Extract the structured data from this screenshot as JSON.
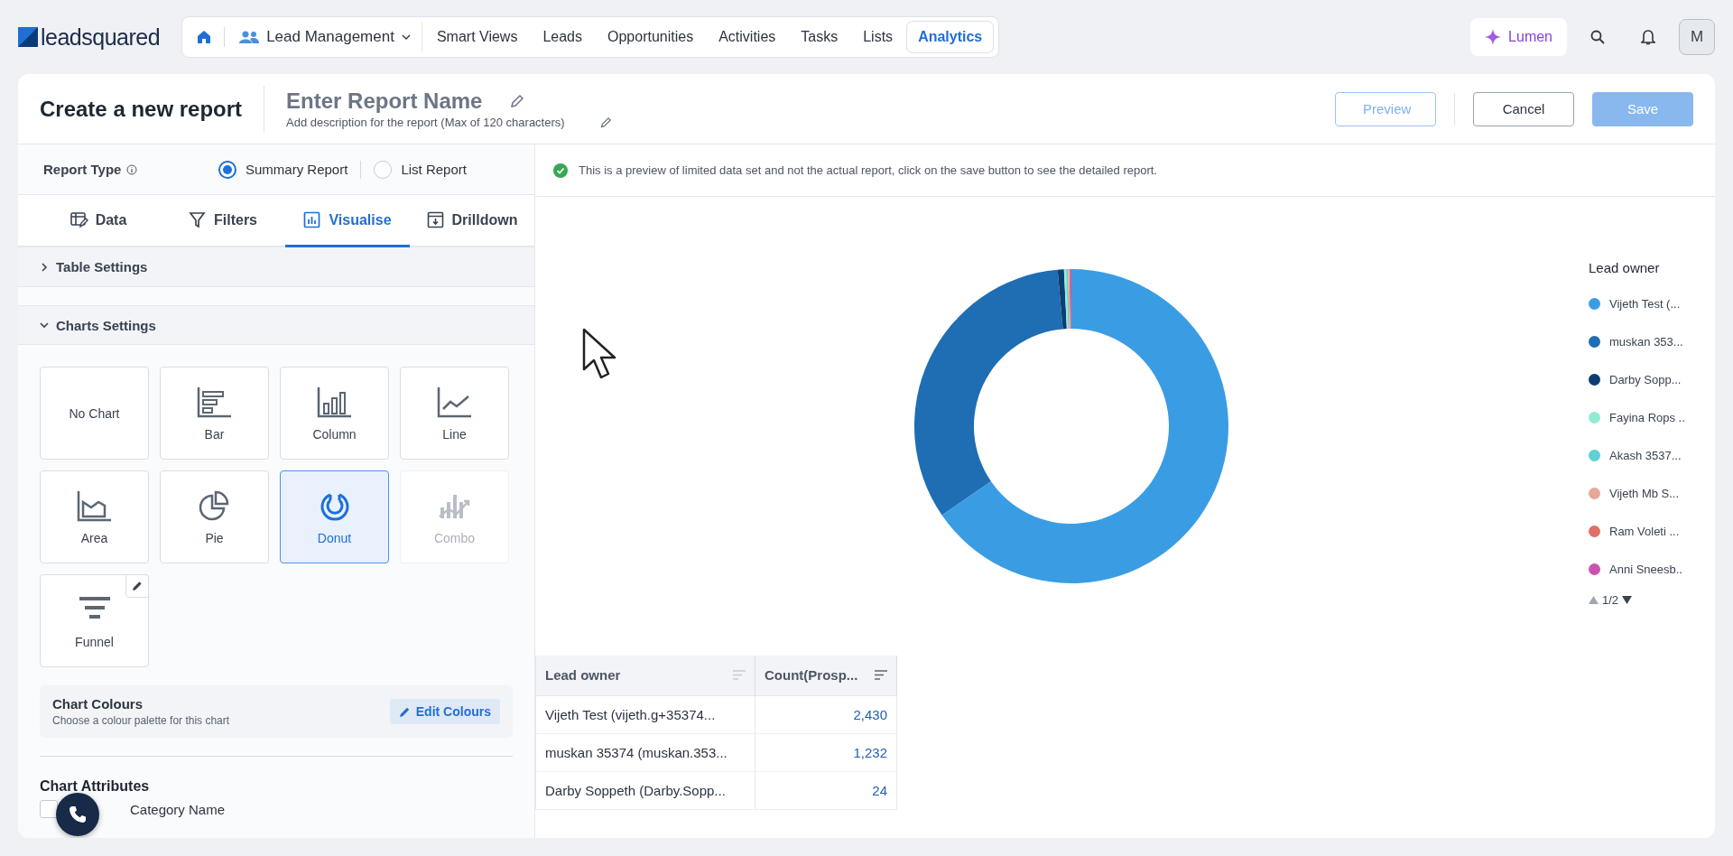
{
  "app": {
    "logo_text": "leadsquared"
  },
  "nav": {
    "module": "Lead Management",
    "items": [
      {
        "label": "Smart Views",
        "selected": false
      },
      {
        "label": "Leads",
        "selected": false
      },
      {
        "label": "Opportunities",
        "selected": false
      },
      {
        "label": "Activities",
        "selected": false
      },
      {
        "label": "Tasks",
        "selected": false
      },
      {
        "label": "Lists",
        "selected": false
      },
      {
        "label": "Analytics",
        "selected": true
      }
    ]
  },
  "top_actions": {
    "lumen": "Lumen",
    "avatar": "M"
  },
  "header": {
    "title": "Create a new report",
    "report_name_placeholder": "Enter Report Name",
    "description_placeholder": "Add description for the report (Max of 120 characters)",
    "buttons": [
      {
        "label": "Preview",
        "kind": "outline"
      },
      {
        "label": "Cancel",
        "kind": "secondary"
      },
      {
        "label": "Save",
        "kind": "primary"
      }
    ]
  },
  "report_type": {
    "label": "Report Type",
    "options": [
      {
        "label": "Summary Report",
        "selected": true
      },
      {
        "label": "List Report",
        "selected": false
      }
    ]
  },
  "tabs": [
    {
      "label": "Data",
      "kind": "data",
      "selected": false
    },
    {
      "label": "Filters",
      "kind": "filter",
      "selected": false
    },
    {
      "label": "Visualise",
      "kind": "chart",
      "selected": true
    },
    {
      "label": "Drilldown",
      "kind": "drilldown",
      "selected": false
    }
  ],
  "sections": [
    {
      "label": "Table Settings",
      "expanded": false
    },
    {
      "label": "Charts Settings",
      "expanded": true
    }
  ],
  "chart_types": [
    {
      "label": "No Chart",
      "kind": "none",
      "selected": false,
      "disabled": false
    },
    {
      "label": "Bar",
      "kind": "bar",
      "selected": false,
      "disabled": false
    },
    {
      "label": "Column",
      "kind": "column",
      "selected": false,
      "disabled": false
    },
    {
      "label": "Line",
      "kind": "line",
      "selected": false,
      "disabled": false
    },
    {
      "label": "Area",
      "kind": "area",
      "selected": false,
      "disabled": false
    },
    {
      "label": "Pie",
      "kind": "pie",
      "selected": false,
      "disabled": false
    },
    {
      "label": "Donut",
      "kind": "donut",
      "selected": true,
      "disabled": false
    },
    {
      "label": "Combo",
      "kind": "combo",
      "selected": false,
      "disabled": true
    },
    {
      "label": "Funnel",
      "kind": "funnel",
      "selected": false,
      "disabled": false,
      "editable": true
    }
  ],
  "chart_colours": {
    "title": "Chart Colours",
    "subtitle": "Choose a colour palette for this chart",
    "button": "Edit Colours"
  },
  "chart_attributes": {
    "title": "Chart Attributes",
    "options": [
      {
        "label": "Category Name",
        "checked": false
      }
    ]
  },
  "notice": "This is a preview of limited data set and not the actual report, click on the save button to see the detailed report.",
  "legend": {
    "title": "Lead owner",
    "pager": "1/2",
    "items": [
      {
        "label": "Vijeth Test (...",
        "color": "#3a9de4"
      },
      {
        "label": "muskan 353...",
        "color": "#1f6db3"
      },
      {
        "label": "Darby Sopp...",
        "color": "#0c3d73"
      },
      {
        "label": "Fayina Rops ..",
        "color": "#93ead6"
      },
      {
        "label": "Akash 3537...",
        "color": "#5fd0d3"
      },
      {
        "label": "Vijeth Mb S...",
        "color": "#e8a898"
      },
      {
        "label": "Ram Voleti ...",
        "color": "#e07068"
      },
      {
        "label": "Anni Sneesb..",
        "color": "#c954b0"
      }
    ]
  },
  "table": {
    "columns": [
      "Lead owner",
      "Count(Prosp..."
    ],
    "rows": [
      [
        "Vijeth Test (vijeth.g+35374...",
        "2,430"
      ],
      [
        "muskan 35374 (muskan.353...",
        "1,232"
      ],
      [
        "Darby Soppeth (Darby.Sopp...",
        "24"
      ]
    ]
  }
}
